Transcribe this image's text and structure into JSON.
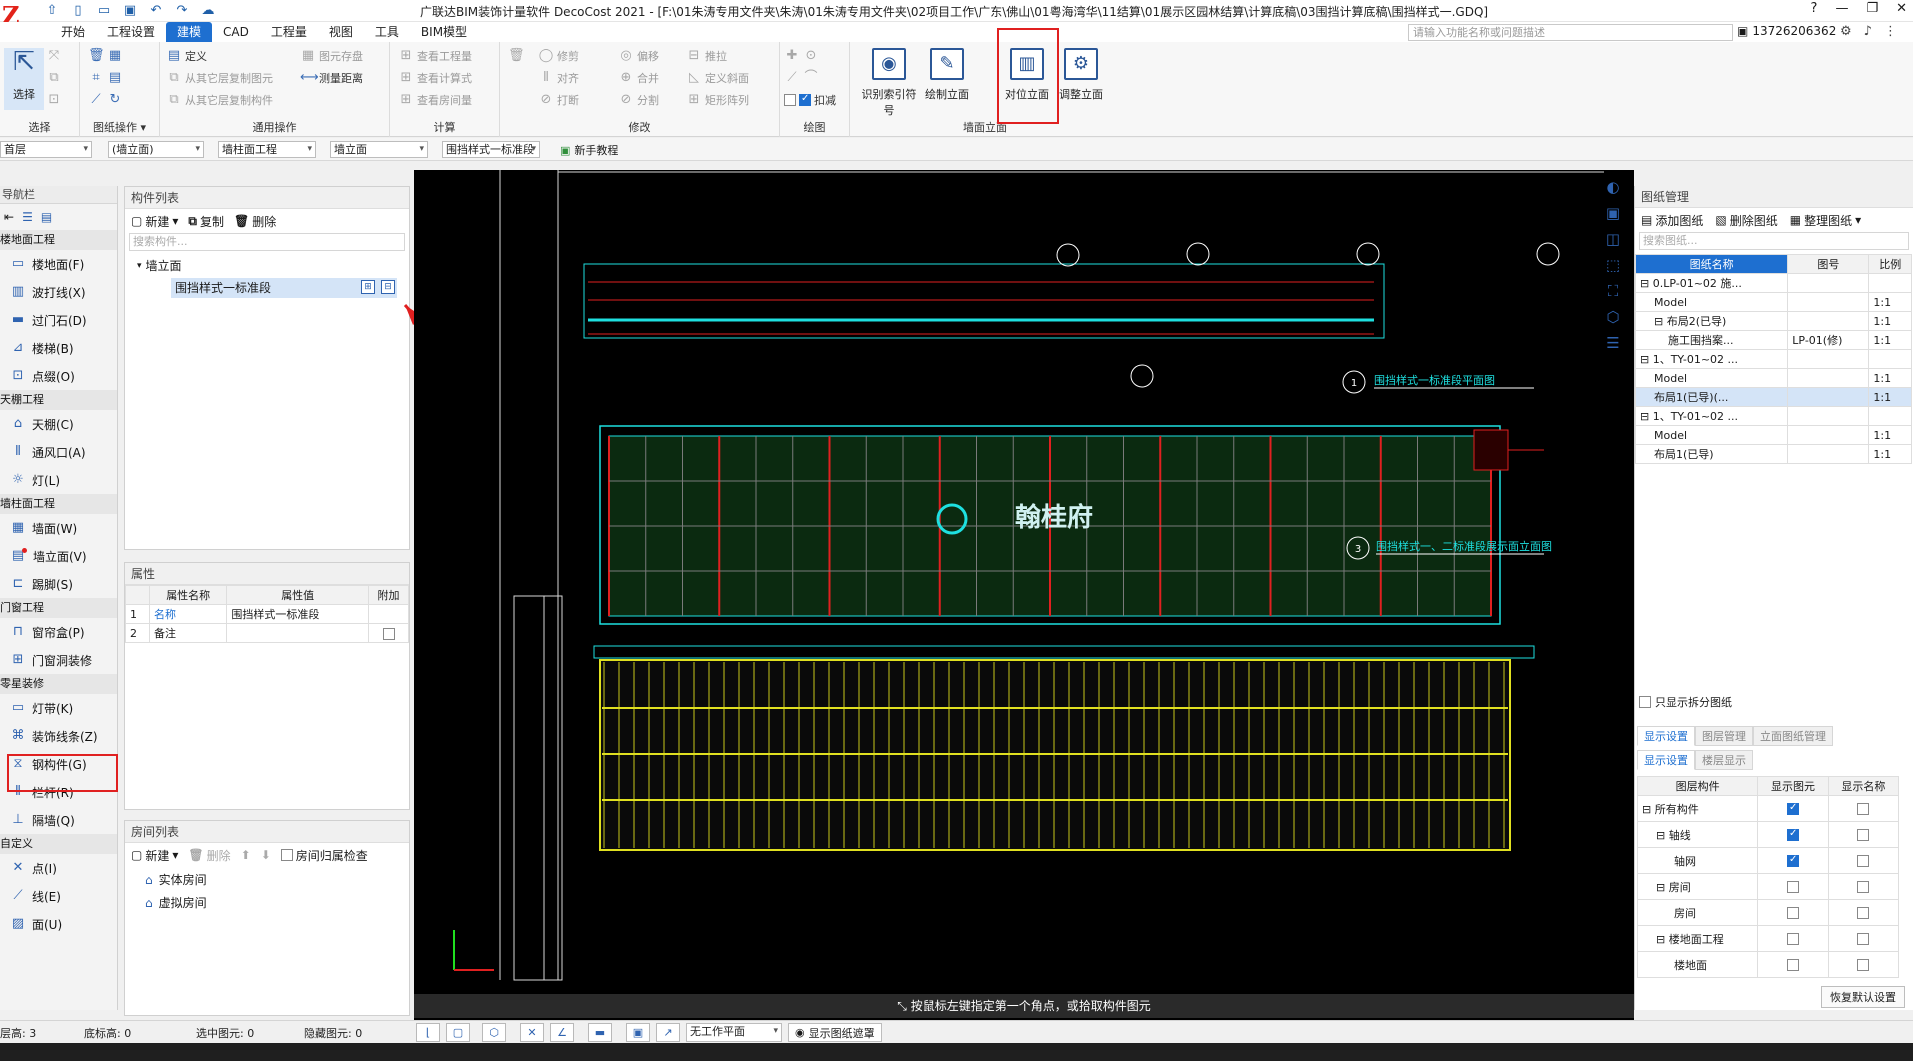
{
  "app": {
    "title": "广联达BIM装饰计量软件 DecoCost 2021 - [F:\\01朱涛专用文件夹\\朱涛\\01朱涛专用文件夹\\02项目工作\\广东\\佛山\\01粤海湾华\\11结算\\01展示区园林结算\\计算底稿\\03围挡计算底稿\\围挡样式一.GDQ]",
    "user": "13726206362",
    "search_placeholder": "请输入功能名称或问题描述"
  },
  "menu_tabs": [
    "开始",
    "工程设置",
    "建模",
    "CAD",
    "工程量",
    "视图",
    "工具",
    "BIM模型"
  ],
  "active_tab": "建模",
  "ribbon": {
    "select": {
      "label": "选择",
      "group": "选择"
    },
    "drawing_ops": {
      "group": "图纸操作 ▾"
    },
    "common": {
      "group": "通用操作",
      "items": [
        "定义",
        "从其它层复制图元",
        "从其它层复制构件",
        "图元存盘",
        "测量距离"
      ]
    },
    "calc": {
      "group": "计算",
      "items": [
        "查看工程量",
        "查看计算式",
        "查看房间量"
      ]
    },
    "modify": {
      "group": "修改",
      "items": [
        "修剪",
        "偏移",
        "推拉",
        "定义斜面",
        "对齐",
        "合并",
        "打断",
        "分割",
        "矩形阵列"
      ]
    },
    "draw": {
      "group": "绘图",
      "items": [
        "扣减"
      ]
    },
    "wall_elev": {
      "group": "墙面立面",
      "buttons": [
        "识别索引符号",
        "绘制立面",
        "对位立面",
        "调整立面"
      ]
    }
  },
  "filters": [
    "首层",
    "(墙立面)",
    "墙柱面工程",
    "墙立面",
    "围挡样式一标准段"
  ],
  "tutorial": "新手教程",
  "nav": {
    "title": "导航栏",
    "categories": [
      {
        "name": "楼地面工程",
        "items": [
          "楼地面(F)",
          "波打线(X)",
          "过门石(D)",
          "楼梯(B)",
          "点缀(O)"
        ]
      },
      {
        "name": "天棚工程",
        "items": [
          "天棚(C)",
          "通风口(A)",
          "灯(L)"
        ]
      },
      {
        "name": "墙柱面工程",
        "items": [
          "墙面(W)",
          "墙立面(V)",
          "踢脚(S)"
        ]
      },
      {
        "name": "门窗工程",
        "items": [
          "窗帘盒(P)",
          "门窗洞装修"
        ]
      },
      {
        "name": "零星装修",
        "items": [
          "灯带(K)",
          "装饰线条(Z)",
          "钢构件(G)",
          "栏杆(R)",
          "隔墙(Q)"
        ]
      },
      {
        "name": "自定义",
        "items": [
          "点(I)",
          "线(E)",
          "面(U)"
        ]
      }
    ],
    "icons": {
      "楼地面(F)": "floor-icon",
      "墙立面(V)": "wall-elevation-icon"
    }
  },
  "component_list": {
    "title": "构件列表",
    "new": "新建",
    "copy": "复制",
    "delete": "删除",
    "search_placeholder": "搜索构件...",
    "group": "墙立面",
    "selected": "围挡样式一标准段"
  },
  "properties": {
    "title": "属性",
    "headers": [
      "属性名称",
      "属性值",
      "附加"
    ],
    "rows": [
      {
        "idx": "1",
        "name": "名称",
        "value": "围挡样式一标准段"
      },
      {
        "idx": "2",
        "name": "备注",
        "value": ""
      }
    ]
  },
  "rooms": {
    "title": "房间列表",
    "new": "新建",
    "delete": "删除",
    "check": "房间归属检查",
    "items": [
      "实体房间",
      "虚拟房间"
    ]
  },
  "canvas": {
    "status": "按鼠标左键指定第一个角点，或拾取构件图元",
    "titles": [
      "围挡样式一标准段平面图",
      "围挡样式一、二标准段展示面立面图"
    ],
    "numbers": [
      "1",
      "3"
    ],
    "sign_text": "翰桂府"
  },
  "drawing_mgmt": {
    "title": "图纸管理",
    "actions": [
      "添加图纸",
      "删除图纸",
      "整理图纸"
    ],
    "search_placeholder": "搜索图纸...",
    "headers": [
      "图纸名称",
      "图号",
      "比例"
    ],
    "rows": [
      {
        "name": "0.LP-01~02 施...",
        "no": "",
        "scale": "",
        "level": 0
      },
      {
        "name": "Model",
        "no": "",
        "scale": "1:1",
        "level": 1
      },
      {
        "name": "布局2(已导)",
        "no": "",
        "scale": "1:1",
        "level": 1
      },
      {
        "name": "施工围挡案...",
        "no": "LP-01(修)",
        "scale": "1:1",
        "level": 2
      },
      {
        "name": "1、TY-01~02 ...",
        "no": "",
        "scale": "",
        "level": 0
      },
      {
        "name": "Model",
        "no": "",
        "scale": "1:1",
        "level": 1
      },
      {
        "name": "布局1(已导)(...",
        "no": "",
        "scale": "1:1",
        "level": 1
      },
      {
        "name": "1、TY-01~02 ...",
        "no": "",
        "scale": "",
        "level": 0
      },
      {
        "name": "Model",
        "no": "",
        "scale": "1:1",
        "level": 1
      },
      {
        "name": "布局1(已导)",
        "no": "",
        "scale": "1:1",
        "level": 1
      }
    ],
    "only_split": "只显示拆分图纸"
  },
  "display": {
    "tabs": [
      "显示设置",
      "图层管理",
      "立面图纸管理"
    ],
    "subtabs": [
      "显示设置",
      "楼层显示"
    ],
    "headers": [
      "图层构件",
      "显示图元",
      "显示名称"
    ],
    "rows": [
      {
        "name": "所有构件",
        "show": true,
        "name_on": false
      },
      {
        "name": "轴线",
        "show": true,
        "name_on": false
      },
      {
        "name": "轴网",
        "show": true,
        "name_on": false
      },
      {
        "name": "房间",
        "show": false,
        "name_on": false
      },
      {
        "name": "房间",
        "show": false,
        "name_on": false
      },
      {
        "name": "楼地面工程",
        "show": false,
        "name_on": false
      },
      {
        "name": "楼地面",
        "show": false,
        "name_on": false
      }
    ],
    "restore": "恢复默认设置"
  },
  "statusbar": {
    "floor_height": "层高: 3",
    "base_height": "底标高: 0",
    "selected": "选中图元: 0",
    "hidden": "隐藏图元: 0",
    "work_plane": "无工作平面",
    "show_mask": "显示图纸遮罩"
  },
  "colors": {
    "accent": "#1e6fd0",
    "highlight": "#e02020",
    "canvas": "#000000"
  }
}
